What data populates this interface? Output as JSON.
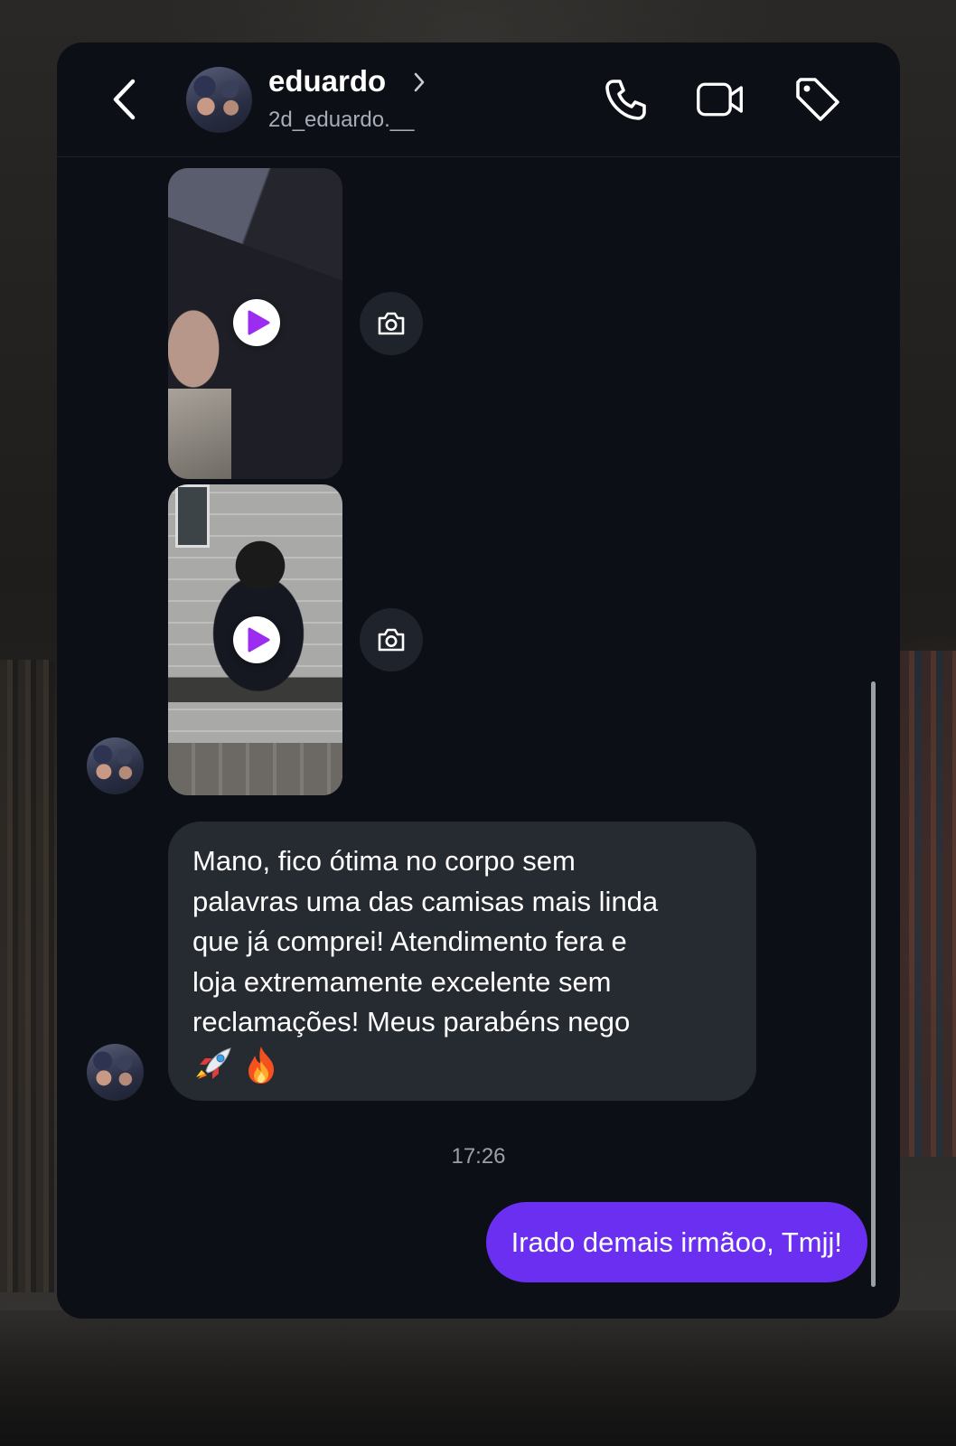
{
  "header": {
    "contact_name": "eduardo",
    "contact_handle": "2d_eduardo.__",
    "icons": [
      "back-icon",
      "chevron-right-icon",
      "phone-icon",
      "video-camera-icon",
      "tag-icon"
    ]
  },
  "messages": [
    {
      "type": "video",
      "sender": "contact",
      "action_icon": "camera-icon"
    },
    {
      "type": "video",
      "sender": "contact",
      "action_icon": "camera-icon"
    },
    {
      "type": "text",
      "sender": "contact",
      "lines": [
        "Mano, fico ótima no corpo sem",
        "palavras uma das camisas mais linda",
        "que já comprei! Atendimento fera e",
        "loja extremamente excelente sem",
        "reclamações! Meus parabéns nego"
      ],
      "emojis": [
        "rocket-emoji",
        "fire-emoji"
      ]
    }
  ],
  "timestamp": "17:26",
  "reply": {
    "sender": "me",
    "text": "Irado demais irmãoo, Tmjj!"
  },
  "colors": {
    "panel_bg": "#0c1016",
    "incoming_bubble": "#262a31",
    "outgoing_bubble": "#6a2ff0",
    "play_icon": "#9b2cf0"
  }
}
